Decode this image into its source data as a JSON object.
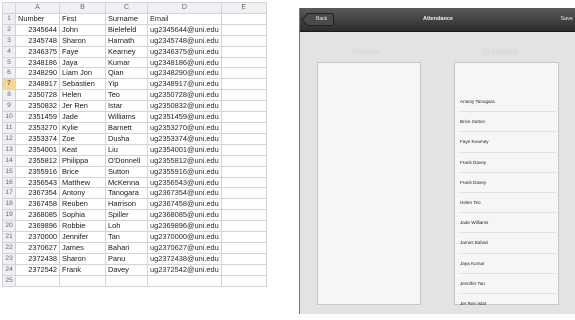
{
  "spreadsheet": {
    "col_letters": [
      "A",
      "B",
      "C",
      "D",
      "E"
    ],
    "selected_row": "7",
    "rows": [
      {
        "n": "1",
        "a": "Number",
        "b": "First",
        "c": "Surname",
        "d": "Email"
      },
      {
        "n": "2",
        "a": "2345644",
        "b": "John",
        "c": "Bielefeld",
        "d": "ug2345644@uni.edu"
      },
      {
        "n": "3",
        "a": "2345748",
        "b": "Sharon",
        "c": "Harnath",
        "d": "ug2345748@uni.edu"
      },
      {
        "n": "4",
        "a": "2346375",
        "b": "Faye",
        "c": "Kearney",
        "d": "ug2346375@uni.edu"
      },
      {
        "n": "5",
        "a": "2348186",
        "b": "Jaya",
        "c": "Kumar",
        "d": "ug2348186@uni.edu"
      },
      {
        "n": "6",
        "a": "2348290",
        "b": "Liam Jon",
        "c": "Qian",
        "d": "ug2348290@uni.edu"
      },
      {
        "n": "7",
        "a": "2348917",
        "b": "Sebastien",
        "c": "Yip",
        "d": "ug2348917@uni.edu"
      },
      {
        "n": "8",
        "a": "2350728",
        "b": "Helen",
        "c": "Teo",
        "d": "ug2350728@uni.edu"
      },
      {
        "n": "9",
        "a": "2350832",
        "b": "Jer Ren",
        "c": "Istar",
        "d": "ug2350832@uni.edu"
      },
      {
        "n": "10",
        "a": "2351459",
        "b": "Jade",
        "c": "Williams",
        "d": "ug2351459@uni.edu"
      },
      {
        "n": "11",
        "a": "2353270",
        "b": "Kylie",
        "c": "Barnett",
        "d": "ug2353270@uni.edu"
      },
      {
        "n": "12",
        "a": "2353374",
        "b": "Zoe",
        "c": "Dusha",
        "d": "ug2353374@uni.edu"
      },
      {
        "n": "13",
        "a": "2354001",
        "b": "Keat",
        "c": "Liu",
        "d": "ug2354001@uni.edu"
      },
      {
        "n": "14",
        "a": "2355812",
        "b": "Philippa",
        "c": "O'Donnell",
        "d": "ug2355812@uni.edu"
      },
      {
        "n": "15",
        "a": "2355916",
        "b": "Brice",
        "c": "Sutton",
        "d": "ug2355916@uni.edu"
      },
      {
        "n": "16",
        "a": "2356543",
        "b": "Matthew",
        "c": "McKenna",
        "d": "ug2356543@uni.edu"
      },
      {
        "n": "17",
        "a": "2367354",
        "b": "Antony",
        "c": "Tanogara",
        "d": "ug2367354@uni.edu"
      },
      {
        "n": "18",
        "a": "2367458",
        "b": "Reuben",
        "c": "Harrison",
        "d": "ug2367458@uni.edu"
      },
      {
        "n": "19",
        "a": "2368085",
        "b": "Sophia",
        "c": "Spiller",
        "d": "ug2368085@uni.edu"
      },
      {
        "n": "20",
        "a": "2369896",
        "b": "Robbie",
        "c": "Loh",
        "d": "ug2369896@uni.edu"
      },
      {
        "n": "21",
        "a": "2370000",
        "b": "Jennifer",
        "c": "Tan",
        "d": "ug2370000@uni.edu"
      },
      {
        "n": "22",
        "a": "2370627",
        "b": "James",
        "c": "Bahari",
        "d": "ug2370627@uni.edu"
      },
      {
        "n": "23",
        "a": "2372438",
        "b": "Sharon",
        "c": "Panu",
        "d": "ug2372438@uni.edu"
      },
      {
        "n": "24",
        "a": "2372542",
        "b": "Frank",
        "c": "Davey",
        "d": "ug2372542@uni.edu"
      },
      {
        "n": "25",
        "a": "",
        "b": "",
        "c": "",
        "d": ""
      }
    ]
  },
  "tablet": {
    "back_label": "Back",
    "title": "Attendance",
    "save_label": "Save",
    "presents_label": "Presents",
    "candidates_label": "Candidates",
    "candidates": [
      "Antony Tanogara",
      "Brice Sutton",
      "Faye Kearney",
      "Frank Davey",
      "Frank Davey",
      "Helen Teo",
      "Jade Williams",
      "James Bahari",
      "Jaya Kumar",
      "Jennifer Tan",
      "Jer Ren Istar"
    ]
  }
}
